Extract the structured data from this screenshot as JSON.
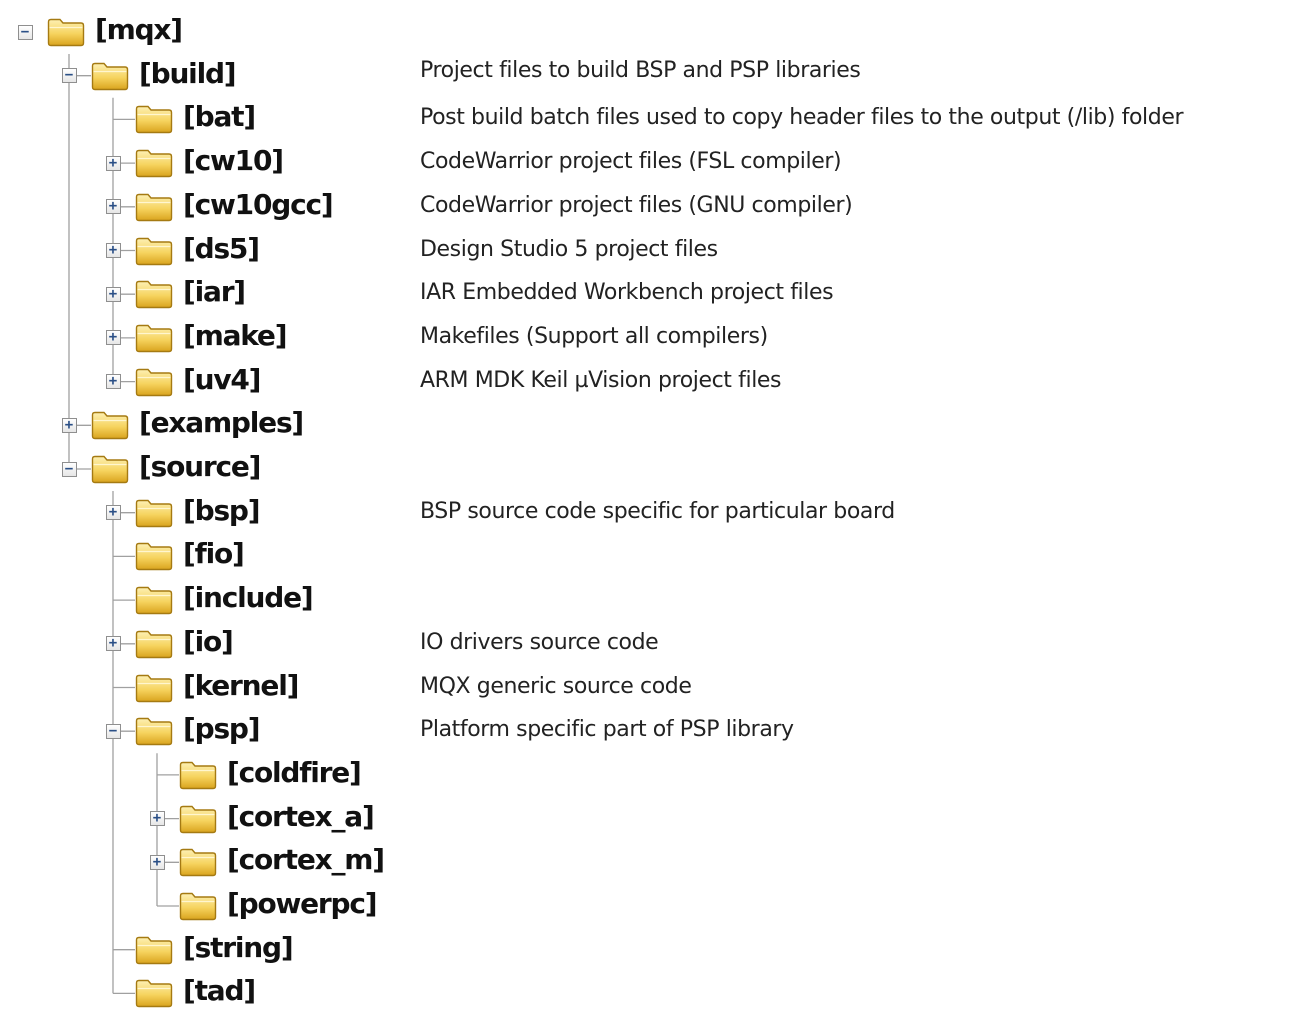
{
  "tree": [
    {
      "id": "mqx",
      "label": "[mqx]",
      "depth": 0,
      "toggle": "minus",
      "desc": ""
    },
    {
      "id": "build",
      "label": "[build]",
      "depth": 1,
      "toggle": "minus",
      "desc": "Project files to build BSP and PSP libraries"
    },
    {
      "id": "bat",
      "label": "[bat]",
      "depth": 2,
      "toggle": "none",
      "desc": "Post build batch files used to copy header files to the output (/lib) folder"
    },
    {
      "id": "cw10",
      "label": "[cw10]",
      "depth": 2,
      "toggle": "plus",
      "desc": "CodeWarrior project files (FSL compiler)"
    },
    {
      "id": "cw10gcc",
      "label": "[cw10gcc]",
      "depth": 2,
      "toggle": "plus",
      "desc": "CodeWarrior project files (GNU compiler)"
    },
    {
      "id": "ds5",
      "label": "[ds5]",
      "depth": 2,
      "toggle": "plus",
      "desc": "Design Studio 5 project files"
    },
    {
      "id": "iar",
      "label": "[iar]",
      "depth": 2,
      "toggle": "plus",
      "desc": "IAR Embedded Workbench project files"
    },
    {
      "id": "make",
      "label": "[make]",
      "depth": 2,
      "toggle": "plus",
      "desc": "Makefiles (Support all compilers)"
    },
    {
      "id": "uv4",
      "label": "[uv4]",
      "depth": 2,
      "toggle": "plus",
      "desc": "ARM MDK Keil µVision project files"
    },
    {
      "id": "examples",
      "label": "[examples]",
      "depth": 1,
      "toggle": "plus",
      "desc": ""
    },
    {
      "id": "source",
      "label": "[source]",
      "depth": 1,
      "toggle": "minus",
      "desc": ""
    },
    {
      "id": "bsp",
      "label": "[bsp]",
      "depth": 2,
      "toggle": "plus",
      "desc": "BSP source code specific for particular board"
    },
    {
      "id": "fio",
      "label": "[fio]",
      "depth": 2,
      "toggle": "none",
      "desc": ""
    },
    {
      "id": "include",
      "label": "[include]",
      "depth": 2,
      "toggle": "none",
      "desc": ""
    },
    {
      "id": "io",
      "label": "[io]",
      "depth": 2,
      "toggle": "plus",
      "desc": "IO drivers source code"
    },
    {
      "id": "kernel",
      "label": "[kernel]",
      "depth": 2,
      "toggle": "none",
      "desc": "MQX generic source code"
    },
    {
      "id": "psp",
      "label": "[psp]",
      "depth": 2,
      "toggle": "minus",
      "desc": "Platform specific part of PSP library"
    },
    {
      "id": "coldfire",
      "label": "[coldfire]",
      "depth": 3,
      "toggle": "none",
      "desc": ""
    },
    {
      "id": "cortex_a",
      "label": "[cortex_a]",
      "depth": 3,
      "toggle": "plus",
      "desc": ""
    },
    {
      "id": "cortex_m",
      "label": "[cortex_m]",
      "depth": 3,
      "toggle": "plus",
      "desc": ""
    },
    {
      "id": "powerpc",
      "label": "[powerpc]",
      "depth": 3,
      "toggle": "none",
      "desc": ""
    },
    {
      "id": "string",
      "label": "[string]",
      "depth": 2,
      "toggle": "none",
      "desc": ""
    },
    {
      "id": "tad",
      "label": "[tad]",
      "depth": 2,
      "toggle": "none",
      "desc": ""
    }
  ],
  "colors": {
    "line": "#a0a0a0",
    "folder_light": "#fdf0b4",
    "folder_mid": "#f6d35e",
    "folder_dark": "#d9a41e",
    "folder_edge": "#a57a12"
  }
}
